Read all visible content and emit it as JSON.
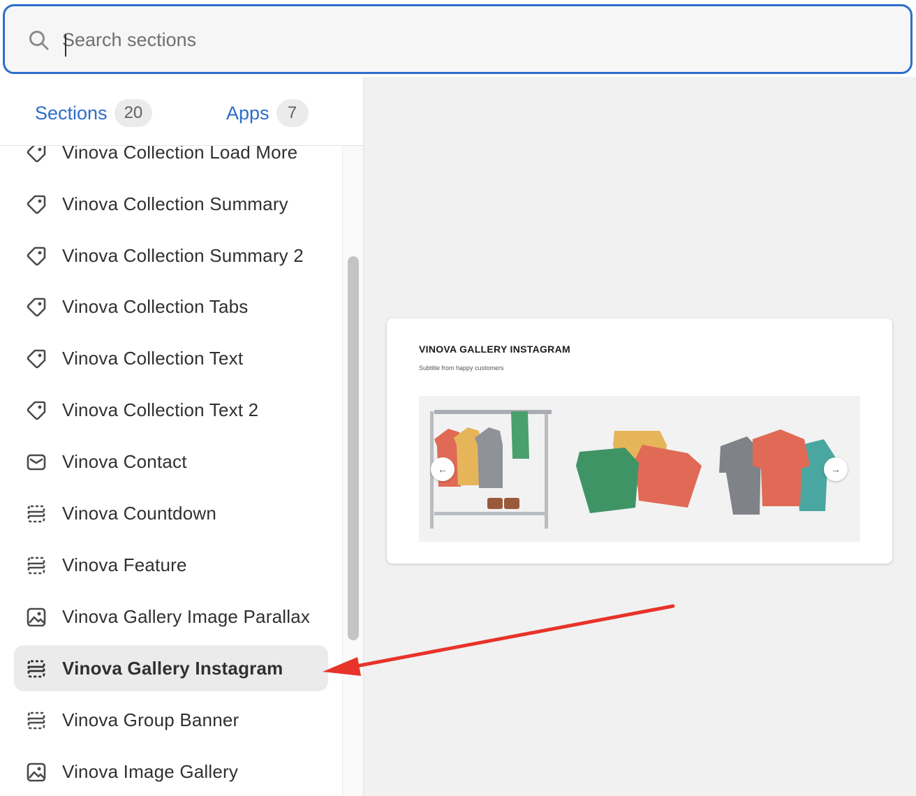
{
  "search": {
    "placeholder": "Search sections",
    "value": ""
  },
  "tabs": [
    {
      "label": "Sections",
      "count": "20"
    },
    {
      "label": "Apps",
      "count": "7"
    }
  ],
  "sections": [
    {
      "label": "Vinova Collection Load More",
      "icon": "tag-icon"
    },
    {
      "label": "Vinova Collection Summary",
      "icon": "tag-icon"
    },
    {
      "label": "Vinova Collection Summary 2",
      "icon": "tag-icon"
    },
    {
      "label": "Vinova Collection Tabs",
      "icon": "tag-icon"
    },
    {
      "label": "Vinova Collection Text",
      "icon": "tag-icon"
    },
    {
      "label": "Vinova Collection Text 2",
      "icon": "tag-icon"
    },
    {
      "label": "Vinova Contact",
      "icon": "envelope-icon"
    },
    {
      "label": "Vinova Countdown",
      "icon": "section-dashed-icon"
    },
    {
      "label": "Vinova Feature",
      "icon": "section-dashed-icon"
    },
    {
      "label": "Vinova Gallery Image Parallax",
      "icon": "image-icon"
    },
    {
      "label": "Vinova Gallery Instagram",
      "icon": "section-dashed-icon",
      "selected": true
    },
    {
      "label": "Vinova Group Banner",
      "icon": "section-dashed-icon"
    },
    {
      "label": "Vinova Image Gallery",
      "icon": "image-icon"
    }
  ],
  "preview": {
    "title": "VINOVA GALLERY INSTAGRAM",
    "subtitle": "Subtitle from happy customers",
    "prev_icon": "arrow-left-icon",
    "next_icon": "arrow-right-icon"
  },
  "colors": {
    "accent": "#2c6ecb",
    "annotation_arrow": "#e8332a",
    "selected_bg": "#ebebeb"
  }
}
